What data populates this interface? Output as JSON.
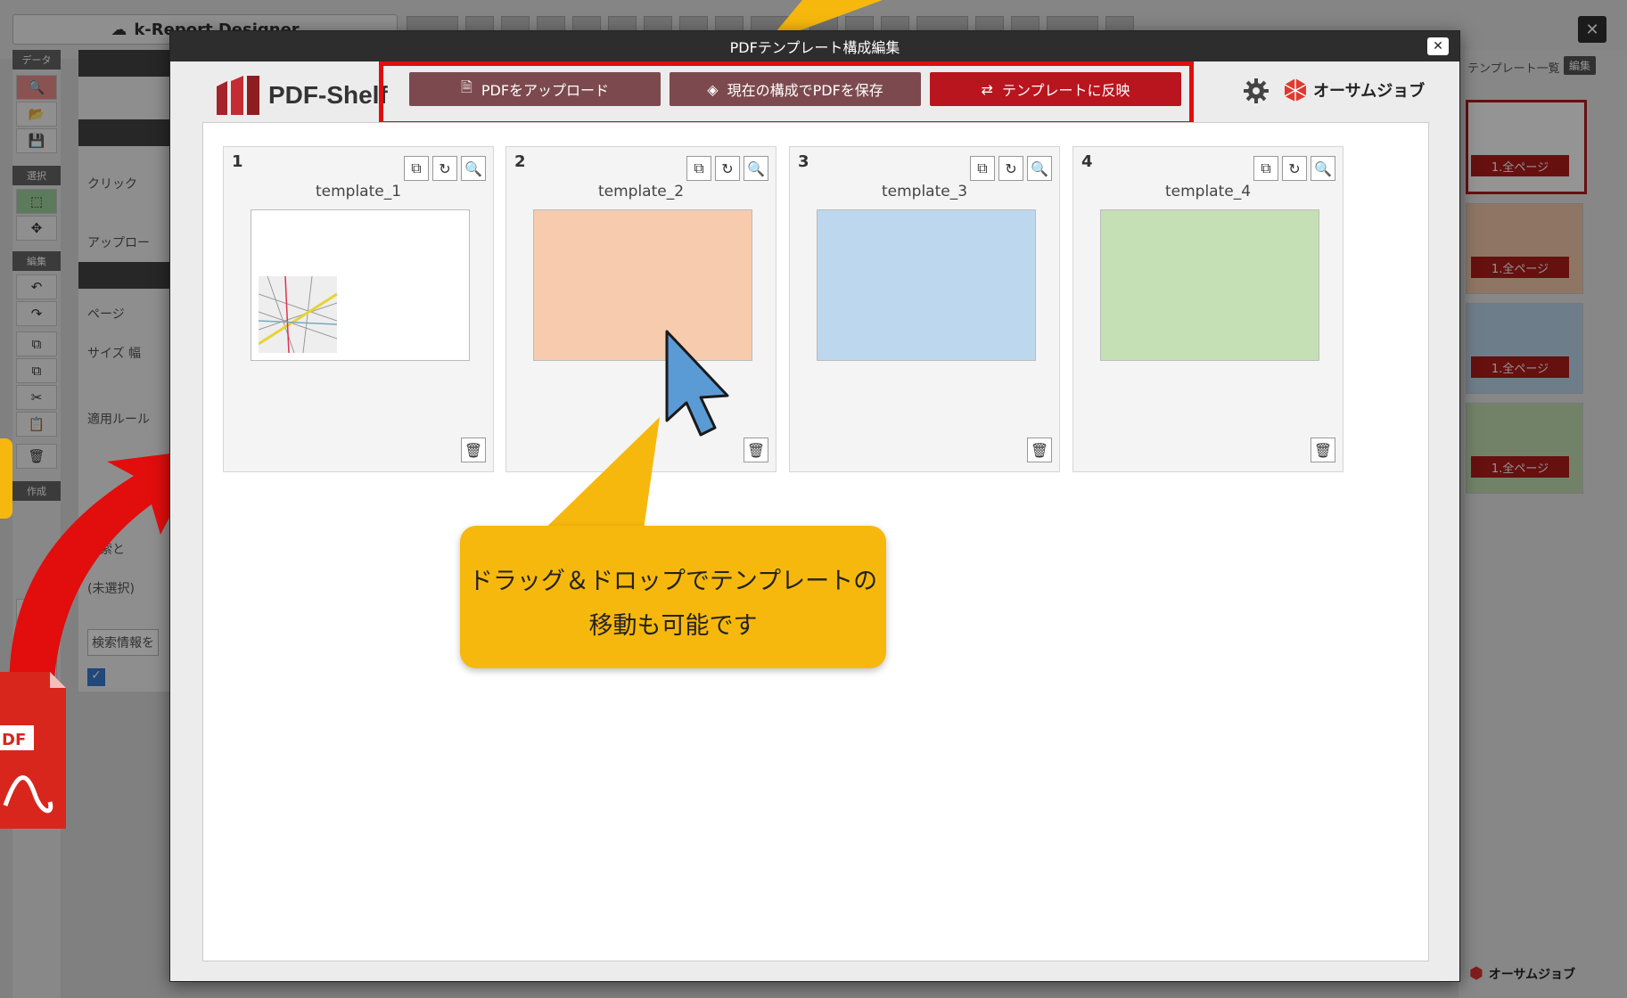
{
  "background": {
    "app_title": "k-Report Designer",
    "close_glyph": "✕",
    "left_sections": [
      "データ",
      "選択",
      "編集",
      "作成"
    ],
    "panel": {
      "click_text": "クリック",
      "upload": "アップロー",
      "page": "ページ",
      "size": "サイズ 幅",
      "rule": "適用ルール",
      "search_head": "検索と",
      "unselected": "(未選択)",
      "search_placeholder": "検索情報を"
    },
    "template_list": {
      "title": "テンプレート一覧",
      "edit": "編集",
      "labels": [
        "1.全ページ",
        "1.全ページ",
        "1.全ページ",
        "1.全ページ"
      ],
      "colors": [
        "#ffffff",
        "#f7cbad",
        "#bdd7ee",
        "#c5e0b4"
      ]
    },
    "brand_bottom": "オーサムジョブ"
  },
  "modal": {
    "title": "PDFテンプレート構成編集",
    "close_glyph": "✕",
    "logo": "PDF-Shelf",
    "brand": "オーサムジョブ",
    "buttons": {
      "upload": "PDFをアップロード",
      "save": "現在の構成でPDFを保存",
      "apply": "テンプレートに反映"
    },
    "cards": [
      {
        "number": "1",
        "name": "template_1",
        "color": "#ffffff"
      },
      {
        "number": "2",
        "name": "template_2",
        "color": "#f7cbad"
      },
      {
        "number": "3",
        "name": "template_3",
        "color": "#bdd7ee"
      },
      {
        "number": "4",
        "name": "template_4",
        "color": "#c5e0b4"
      }
    ]
  },
  "callout": {
    "line1": "ドラッグ＆ドロップでテンプレートの",
    "line2": "移動も可能です",
    "color": "#f7b80d"
  },
  "accent_colors": {
    "highlight_border": "#e20d0d",
    "arrow": "#e20d0d",
    "cursor": "#5b9bd5"
  }
}
